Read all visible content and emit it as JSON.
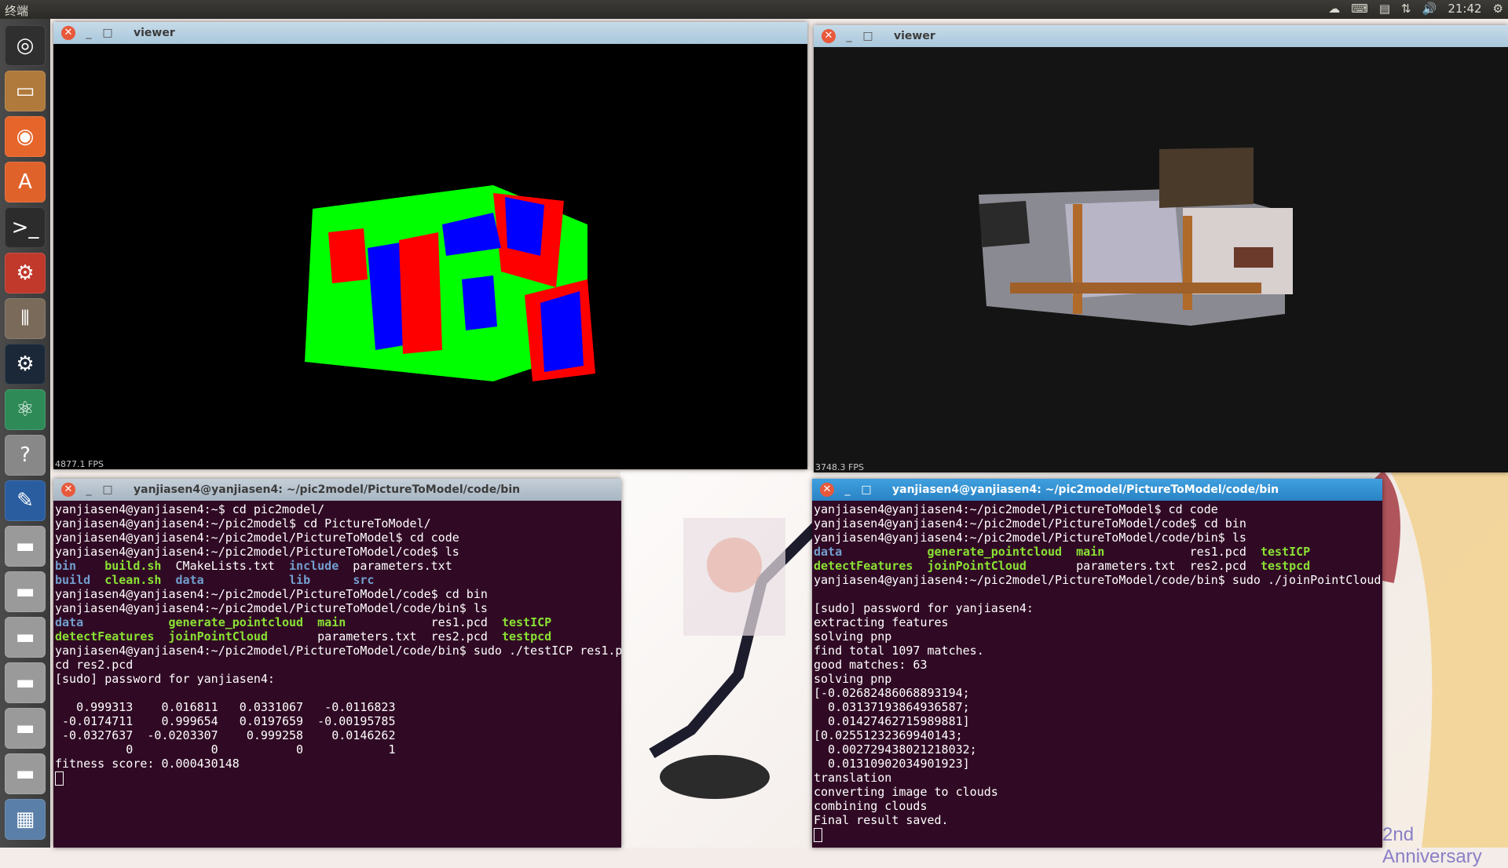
{
  "panel": {
    "title": "终端",
    "time": "21:42",
    "tray_icons": [
      "dropbox-icon",
      "keyboard-icon",
      "calendar-icon",
      "network-icon",
      "volume-icon",
      "settings-icon"
    ]
  },
  "launcher": {
    "items": [
      "ubuntu-dash-icon",
      "files-icon",
      "firefox-icon",
      "software-center-icon",
      "terminal-icon",
      "system-settings-icon",
      "mixer-icon",
      "steam-icon",
      "atom-icon",
      "help-icon",
      "editor-icon",
      "drive-icon",
      "drive-icon",
      "drive-icon",
      "drive-icon",
      "drive-icon",
      "drive-icon",
      "workspace-icon"
    ]
  },
  "viewer_left": {
    "title": "viewer",
    "fps": "4877.1 FPS"
  },
  "viewer_right": {
    "title": "viewer",
    "fps": "3748.3 FPS"
  },
  "term_left": {
    "title": "yanjiasen4@yanjiasen4: ~/pic2model/PictureToModel/code/bin",
    "lines": [
      [
        {
          "t": "yanjiasen4@yanjiasen4:~$ cd pic2model/"
        }
      ],
      [
        {
          "t": "yanjiasen4@yanjiasen4:~/pic2model$ cd PictureToModel/"
        }
      ],
      [
        {
          "t": "yanjiasen4@yanjiasen4:~/pic2model/PictureToModel$ cd code"
        }
      ],
      [
        {
          "t": "yanjiasen4@yanjiasen4:~/pic2model/PictureToModel/code$ ls"
        }
      ],
      [
        {
          "t": "bin",
          "c": "b"
        },
        {
          "t": "    "
        },
        {
          "t": "build.sh",
          "c": "g"
        },
        {
          "t": "  CMakeLists.txt  "
        },
        {
          "t": "include",
          "c": "b"
        },
        {
          "t": "  parameters.txt"
        }
      ],
      [
        {
          "t": "build",
          "c": "b"
        },
        {
          "t": "  "
        },
        {
          "t": "clean.sh",
          "c": "g"
        },
        {
          "t": "  "
        },
        {
          "t": "data",
          "c": "b"
        },
        {
          "t": "            "
        },
        {
          "t": "lib",
          "c": "b"
        },
        {
          "t": "      "
        },
        {
          "t": "src",
          "c": "b"
        }
      ],
      [
        {
          "t": "yanjiasen4@yanjiasen4:~/pic2model/PictureToModel/code$ cd bin"
        }
      ],
      [
        {
          "t": "yanjiasen4@yanjiasen4:~/pic2model/PictureToModel/code/bin$ ls"
        }
      ],
      [
        {
          "t": "data",
          "c": "b"
        },
        {
          "t": "            "
        },
        {
          "t": "generate_pointcloud",
          "c": "g"
        },
        {
          "t": "  "
        },
        {
          "t": "main",
          "c": "g"
        },
        {
          "t": "            res1.pcd  "
        },
        {
          "t": "testICP",
          "c": "g"
        }
      ],
      [
        {
          "t": "detectFeatures",
          "c": "g"
        },
        {
          "t": "  "
        },
        {
          "t": "joinPointCloud",
          "c": "g"
        },
        {
          "t": "       parameters.txt  res2.pcd  "
        },
        {
          "t": "testpcd",
          "c": "g"
        }
      ],
      [
        {
          "t": "yanjiasen4@yanjiasen4:~/pic2model/PictureToModel/code/bin$ sudo ./testICP res1.p"
        }
      ],
      [
        {
          "t": "cd res2.pcd"
        }
      ],
      [
        {
          "t": "[sudo] password for yanjiasen4:"
        }
      ],
      [
        {
          "t": ""
        }
      ],
      [
        {
          "t": "   0.999313    0.016811   0.0331067   -0.0116823"
        }
      ],
      [
        {
          "t": " -0.0174711    0.999654   0.0197659  -0.00195785"
        }
      ],
      [
        {
          "t": " -0.0327637  -0.0203307    0.999258    0.0146262"
        }
      ],
      [
        {
          "t": "          0           0           0            1"
        }
      ],
      [
        {
          "t": "fitness score: 0.000430148"
        }
      ]
    ]
  },
  "term_right": {
    "title": "yanjiasen4@yanjiasen4: ~/pic2model/PictureToModel/code/bin",
    "lines": [
      [
        {
          "t": "yanjiasen4@yanjiasen4:~/pic2model/PictureToModel$ cd code"
        }
      ],
      [
        {
          "t": "yanjiasen4@yanjiasen4:~/pic2model/PictureToModel/code$ cd bin"
        }
      ],
      [
        {
          "t": "yanjiasen4@yanjiasen4:~/pic2model/PictureToModel/code/bin$ ls"
        }
      ],
      [
        {
          "t": "data",
          "c": "b"
        },
        {
          "t": "            "
        },
        {
          "t": "generate_pointcloud",
          "c": "g"
        },
        {
          "t": "  "
        },
        {
          "t": "main",
          "c": "g"
        },
        {
          "t": "            res1.pcd  "
        },
        {
          "t": "testICP",
          "c": "g"
        }
      ],
      [
        {
          "t": "detectFeatures",
          "c": "g"
        },
        {
          "t": "  "
        },
        {
          "t": "joinPointCloud",
          "c": "g"
        },
        {
          "t": "       parameters.txt  res2.pcd  "
        },
        {
          "t": "testpcd",
          "c": "g"
        }
      ],
      [
        {
          "t": "yanjiasen4@yanjiasen4:~/pic2model/PictureToModel/code/bin$ sudo ./joinPointCloud"
        }
      ],
      [
        {
          "t": ""
        }
      ],
      [
        {
          "t": "[sudo] password for yanjiasen4:"
        }
      ],
      [
        {
          "t": "extracting features"
        }
      ],
      [
        {
          "t": "solving pnp"
        }
      ],
      [
        {
          "t": "find total 1097 matches."
        }
      ],
      [
        {
          "t": "good matches: 63"
        }
      ],
      [
        {
          "t": "solving pnp"
        }
      ],
      [
        {
          "t": "[-0.02682486068893194;"
        }
      ],
      [
        {
          "t": "  0.03137193864936587;"
        }
      ],
      [
        {
          "t": "  0.01427462715989881]"
        }
      ],
      [
        {
          "t": "[0.02551232369940143;"
        }
      ],
      [
        {
          "t": "  0.002729438021218032;"
        }
      ],
      [
        {
          "t": "  0.01310902034901923]"
        }
      ],
      [
        {
          "t": "translation"
        }
      ],
      [
        {
          "t": "converting image to clouds"
        }
      ],
      [
        {
          "t": "combining clouds"
        }
      ],
      [
        {
          "t": "Final result saved."
        }
      ]
    ]
  },
  "wallpaper": {
    "caption": "2nd Anniversary"
  }
}
